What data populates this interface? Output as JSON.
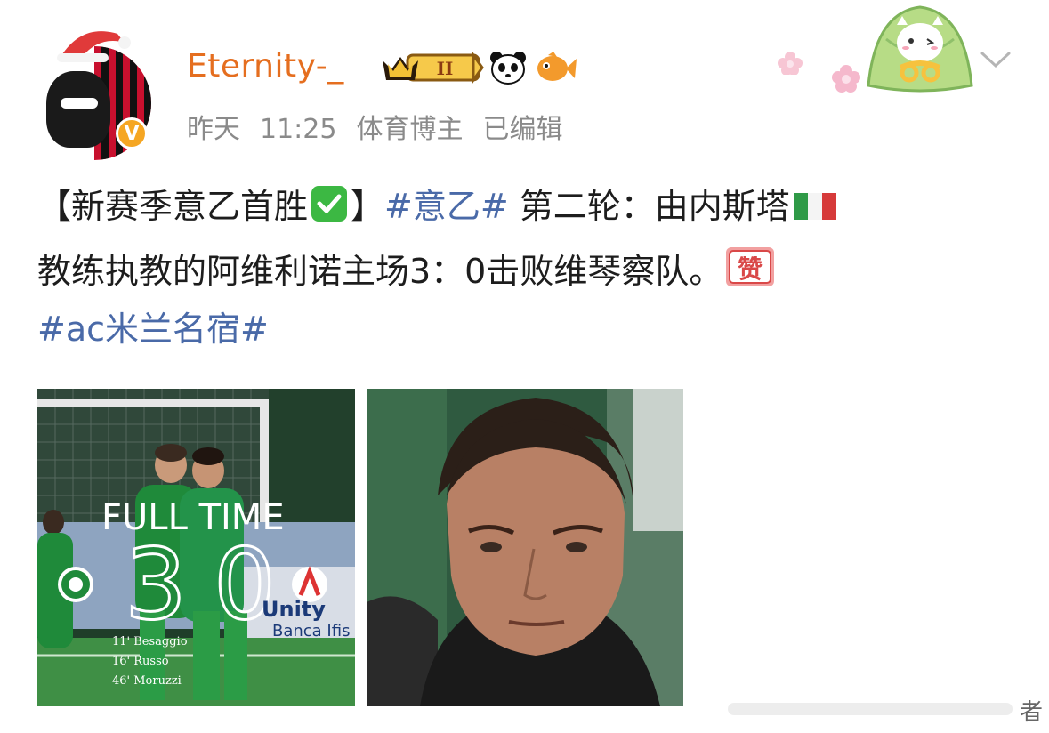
{
  "post": {
    "author": {
      "name": "Eternity-_",
      "verified_mark": "V",
      "level_badge": "II",
      "badges": [
        "crown-icon",
        "panda-icon",
        "fish-icon"
      ]
    },
    "meta": {
      "day": "昨天",
      "time": "11:25",
      "category": "体育博主",
      "edited": "已编辑"
    },
    "content": {
      "headline": "【新赛季意乙首胜",
      "headline_close": "】",
      "hashtag1": "#意乙#",
      "line1_rest": " 第二轮：由内斯塔",
      "line2": "教练执教的阿维利诺主场3：0击败维琴察队。",
      "hashtag2": "#ac米兰名宿#"
    },
    "images": {
      "photo1": {
        "heading": "FULL TIME",
        "score_home": "3",
        "score_away": "0",
        "scorers": [
          "11' Besaggio",
          "16' Russo",
          "46' Moruzzi"
        ],
        "ad_text1": "Unity",
        "ad_text2": "Banca Ifis"
      }
    },
    "footer": {
      "char": "者"
    },
    "colors": {
      "username": "#e56e1f",
      "hashtag": "#4a6aa8",
      "meta": "#8a8a8a",
      "jersey": "#1f8a3a"
    }
  }
}
